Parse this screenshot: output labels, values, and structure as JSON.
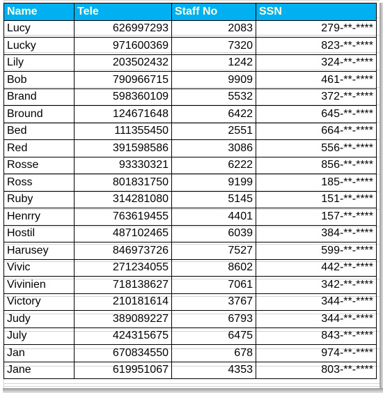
{
  "table": {
    "headers": [
      "Name",
      "Tele",
      "Staff No",
      "SSN"
    ],
    "header_bg": "#00b0f0",
    "header_text_color": "#fffbe0",
    "rows": [
      {
        "name": "Lucy",
        "tele": "626997293",
        "staff_no": "2083",
        "ssn": "279-**-****"
      },
      {
        "name": "Lucky",
        "tele": "971600369",
        "staff_no": "7320",
        "ssn": "823-**-****"
      },
      {
        "name": "Lily",
        "tele": "203502432",
        "staff_no": "1242",
        "ssn": "324-**-****"
      },
      {
        "name": "Bob",
        "tele": "790966715",
        "staff_no": "9909",
        "ssn": "461-**-****"
      },
      {
        "name": "Brand",
        "tele": "598360109",
        "staff_no": "5532",
        "ssn": "372-**-****"
      },
      {
        "name": "Bround",
        "tele": "124671648",
        "staff_no": "6422",
        "ssn": "645-**-****"
      },
      {
        "name": "Bed",
        "tele": "111355450",
        "staff_no": "2551",
        "ssn": "664-**-****"
      },
      {
        "name": "Red",
        "tele": "391598586",
        "staff_no": "3086",
        "ssn": "556-**-****"
      },
      {
        "name": "Rosse",
        "tele": "93330321",
        "staff_no": "6222",
        "ssn": "856-**-****"
      },
      {
        "name": "Ross",
        "tele": "801831750",
        "staff_no": "9199",
        "ssn": "185-**-****"
      },
      {
        "name": "Ruby",
        "tele": "314281080",
        "staff_no": "5145",
        "ssn": "151-**-****"
      },
      {
        "name": "Henrry",
        "tele": "763619455",
        "staff_no": "4401",
        "ssn": "157-**-****"
      },
      {
        "name": "Hostil",
        "tele": "487102465",
        "staff_no": "6039",
        "ssn": "384-**-****"
      },
      {
        "name": "Harusey",
        "tele": "846973726",
        "staff_no": "7527",
        "ssn": "599-**-****"
      },
      {
        "name": "Vivic",
        "tele": "271234055",
        "staff_no": "8602",
        "ssn": "442-**-****"
      },
      {
        "name": "Vivinien",
        "tele": "718138627",
        "staff_no": "7061",
        "ssn": "342-**-****"
      },
      {
        "name": "Victory",
        "tele": "210181614",
        "staff_no": "3767",
        "ssn": "344-**-****"
      },
      {
        "name": "Judy",
        "tele": "389089227",
        "staff_no": "6793",
        "ssn": "344-**-****"
      },
      {
        "name": "July",
        "tele": "424315675",
        "staff_no": "6475",
        "ssn": "843-**-****"
      },
      {
        "name": "Jan",
        "tele": "670834550",
        "staff_no": "678",
        "ssn": "974-**-****"
      },
      {
        "name": "Jane",
        "tele": "619951067",
        "staff_no": "4353",
        "ssn": "803-**-****"
      }
    ]
  }
}
